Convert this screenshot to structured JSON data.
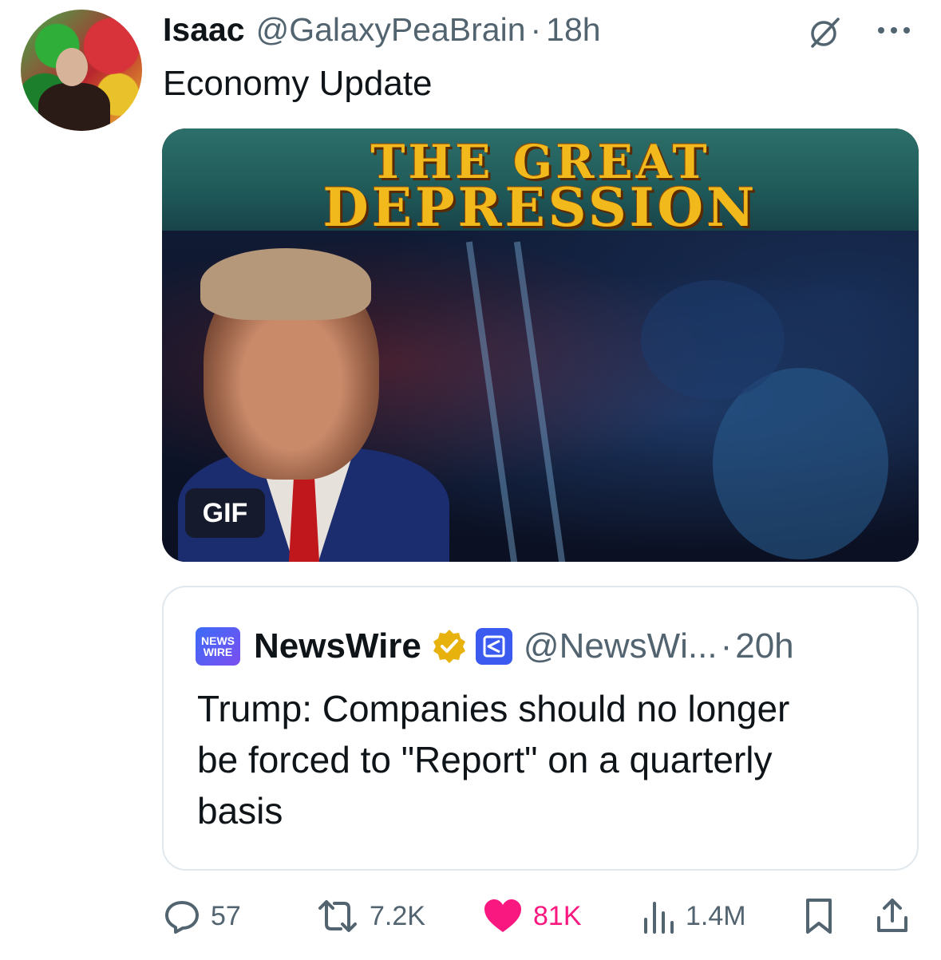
{
  "tweet": {
    "author_name": "Isaac",
    "author_handle": "@GalaxyPeaBrain",
    "separator": "·",
    "time": "18h",
    "text": "Economy Update",
    "media": {
      "title_line1": "THE GREAT",
      "title_line2": "DEPRESSION",
      "badge": "GIF"
    }
  },
  "quoted": {
    "logo_top": "NEWS",
    "logo_bottom": "WIRE",
    "name": "NewsWire",
    "handle": "@NewsWi...",
    "separator": "·",
    "time": "20h",
    "text_lines": [
      "Trump: Companies should no longer",
      "be forced to \"Report\" on a quarterly",
      "basis"
    ]
  },
  "actions": {
    "replies": "57",
    "reposts": "7.2K",
    "likes": "81K",
    "views": "1.4M"
  },
  "colors": {
    "text_primary": "#0f1419",
    "text_secondary": "#536471",
    "like": "#f91880",
    "verified": "#e8b20e",
    "affiliate": "#3b5bf0",
    "border": "#e1e8ed"
  },
  "icons": [
    "grok-icon",
    "more-icon",
    "verified-gold-icon",
    "affiliate-icon",
    "reply-icon",
    "retweet-icon",
    "heart-icon",
    "views-icon",
    "bookmark-icon",
    "share-icon"
  ]
}
